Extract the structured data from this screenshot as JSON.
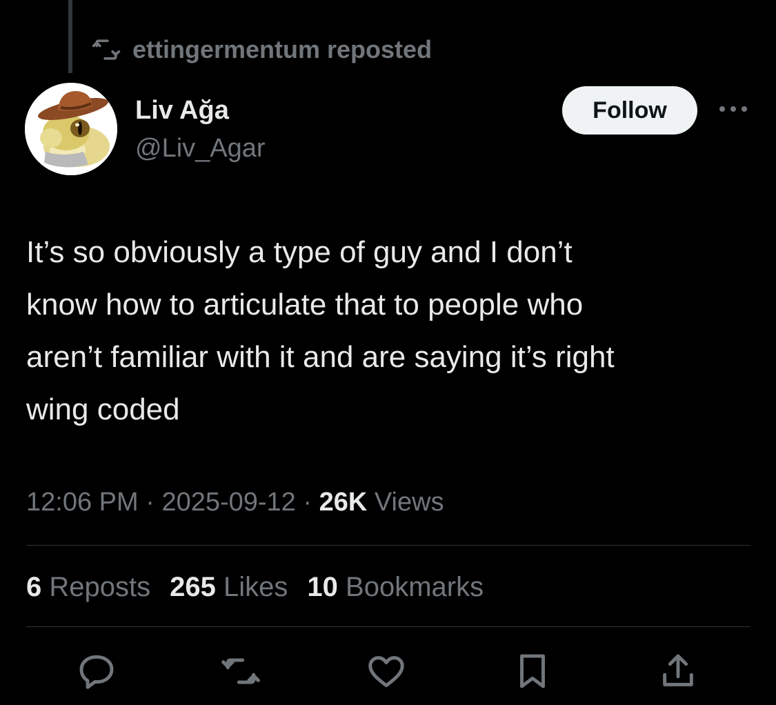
{
  "repost_banner": {
    "icon": "repost-icon",
    "text": "ettingermentum reposted"
  },
  "author": {
    "avatar_icon": "gecko-cowboy-hat-avatar",
    "name": "Liv Ağa",
    "handle": "@Liv_Agar"
  },
  "follow_button": {
    "label": "Follow"
  },
  "more_button": {
    "icon": "more-horizontal-icon"
  },
  "tweet": {
    "text": "It’s so obviously a type of guy and I don’t\nknow how to articulate that to people who\naren’t familiar with it and are saying it’s right\nwing coded"
  },
  "meta": {
    "time": "12:06 PM",
    "separator": "·",
    "date": "2025-09-12",
    "views_count": "26K",
    "views_label": "Views"
  },
  "stats": {
    "reposts_count": "6",
    "reposts_label": "Reposts",
    "likes_count": "265",
    "likes_label": "Likes",
    "bookmarks_count": "10",
    "bookmarks_label": "Bookmarks"
  },
  "actions": [
    {
      "icon": "reply-icon"
    },
    {
      "icon": "repost-icon"
    },
    {
      "icon": "like-icon"
    },
    {
      "icon": "bookmark-icon"
    },
    {
      "icon": "share-icon"
    }
  ],
  "colors": {
    "background": "#000000",
    "primary_text": "#e7e9ea",
    "secondary_text": "#71767b",
    "divider": "#2f3336",
    "follow_button_bg": "#eff3f4"
  }
}
